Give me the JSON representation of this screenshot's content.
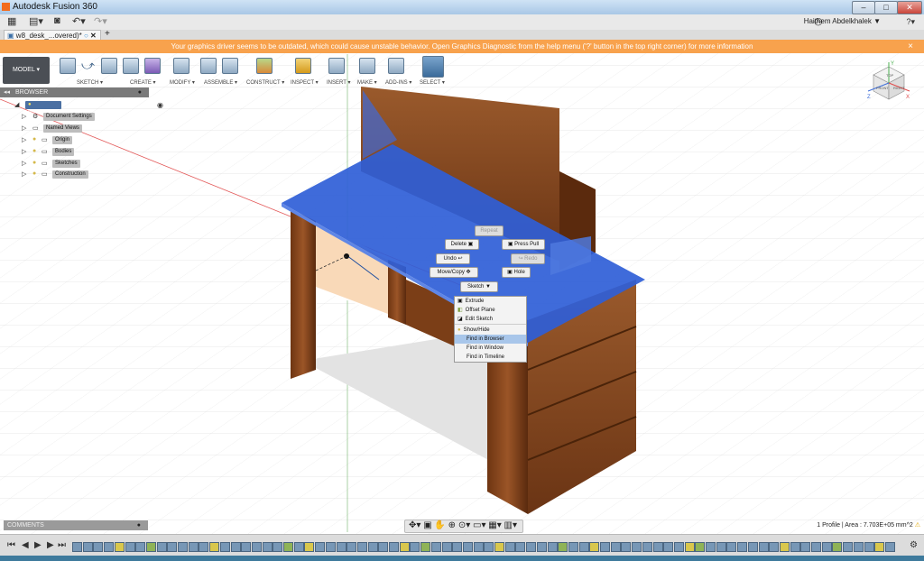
{
  "window": {
    "title": "Autodesk Fusion 360",
    "minimize": "–",
    "maximize": "□",
    "close": "✕",
    "close_color": "#c9453a"
  },
  "qab": {
    "user_name": "Haithem Abdelkhalek ▼",
    "help_label": "?▾"
  },
  "tab": {
    "label": "w8_desk_...overed)*",
    "add_label": "+"
  },
  "warning": {
    "text": "Your graphics driver seems to be outdated, which could cause unstable behavior. Open Graphics Diagnostic from the help menu ('?' button in the top right corner) for more information",
    "close": "×"
  },
  "toolbar": {
    "model_label": "MODEL ▾",
    "groups": [
      "SKETCH ▾",
      "CREATE ▾",
      "MODIFY ▾",
      "ASSEMBLE ▾",
      "CONSTRUCT ▾",
      "INSPECT ▾",
      "INSERT ▾",
      "MAKE ▾",
      "ADD-INS ▾",
      "SELECT ▾"
    ]
  },
  "viewcube": {
    "top": "TOP",
    "front": "FRONT",
    "right": "RIGHT",
    "axis_x": "X",
    "axis_y": "Y",
    "axis_z": "Z"
  },
  "browser": {
    "title": "BROWSER",
    "root": "w8_desk_06 (v4-recovered)",
    "items": [
      "Document Settings",
      "Named Views",
      "Origin",
      "Bodies",
      "Sketches",
      "Construction"
    ]
  },
  "marking_menu": {
    "repeat": "Repeat",
    "delete": "Delete",
    "press_pull": "Press Pull",
    "undo": "Undo",
    "redo": "Redo",
    "move_copy": "Move/Copy",
    "hole": "Hole",
    "sketch": "Sketch ▼"
  },
  "context_menu": {
    "items": [
      "Extrude",
      "Offset Plane",
      "Edit Sketch",
      "Show/Hide",
      "Find in Browser",
      "Find in Window",
      "Find in Timeline"
    ],
    "highlighted": "Find in Browser"
  },
  "comments": {
    "label": "COMMENTS"
  },
  "status": {
    "text": "1 Profile | Area : 7.703E+05 mm^2"
  },
  "timeline": {
    "first": "⏮",
    "prev": "◀",
    "play": "▶",
    "next": "▶",
    "last": "⏭"
  },
  "colors": {
    "warning": "#f8a24d",
    "selection_blue": "#2f5ed7",
    "wood": "#8a4a1e"
  }
}
